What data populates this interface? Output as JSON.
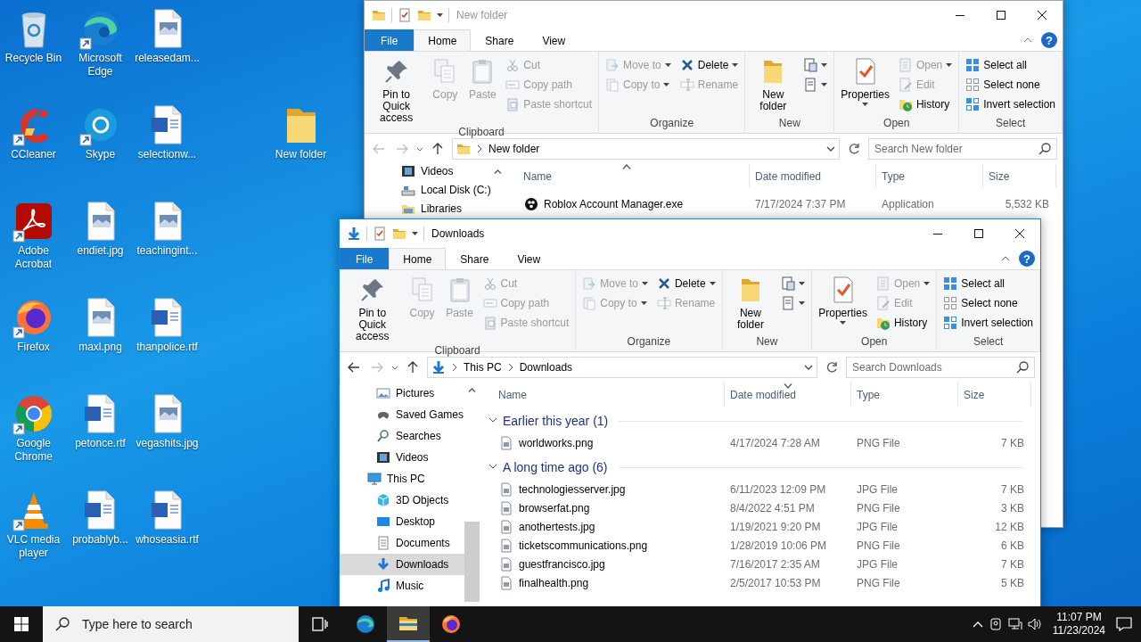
{
  "desktop": {
    "icons": [
      {
        "label": "Recycle Bin",
        "shortcut": false
      },
      {
        "label": "CCleaner",
        "shortcut": true
      },
      {
        "label": "Adobe Acrobat",
        "shortcut": true
      },
      {
        "label": "Firefox",
        "shortcut": true
      },
      {
        "label": "Google Chrome",
        "shortcut": true
      },
      {
        "label": "VLC media player",
        "shortcut": true
      },
      {
        "label": "Microsoft Edge",
        "shortcut": true
      },
      {
        "label": "Skype",
        "shortcut": true
      },
      {
        "label": "endiet.jpg",
        "shortcut": false
      },
      {
        "label": "maxl.png",
        "shortcut": false
      },
      {
        "label": "petonce.rtf",
        "shortcut": false
      },
      {
        "label": "probablyb...",
        "shortcut": false
      },
      {
        "label": "releasedam...",
        "shortcut": false
      },
      {
        "label": "selectionw...",
        "shortcut": false
      },
      {
        "label": "teachingint...",
        "shortcut": false
      },
      {
        "label": "thanpolice.rtf",
        "shortcut": false
      },
      {
        "label": "vegashits.jpg",
        "shortcut": false
      },
      {
        "label": "whoseasia.rtf",
        "shortcut": false
      }
    ],
    "folder": {
      "label": "New folder"
    }
  },
  "windows": [
    {
      "title": "New folder",
      "active": false,
      "tabs": [
        {
          "label": "File",
          "kind": "file",
          "selected": false
        },
        {
          "label": "Home",
          "kind": "tab",
          "selected": true
        },
        {
          "label": "Share",
          "kind": "tab",
          "selected": false
        },
        {
          "label": "View",
          "kind": "tab",
          "selected": false
        }
      ],
      "help": "?",
      "groups": [
        {
          "label": "Clipboard",
          "columns": [
            [
              {
                "label": "Pin to Quick access",
                "kind": "large",
                "disabled": false,
                "dropdown": false
              }
            ],
            [
              {
                "label": "Copy",
                "kind": "large",
                "disabled": true,
                "dropdown": false
              }
            ],
            [
              {
                "label": "Paste",
                "kind": "large",
                "disabled": true,
                "dropdown": false
              }
            ],
            [
              {
                "label": "Cut",
                "kind": "small",
                "disabled": true,
                "dropdown": false
              },
              {
                "label": "Copy path",
                "kind": "small",
                "disabled": true,
                "dropdown": false
              },
              {
                "label": "Paste shortcut",
                "kind": "small",
                "disabled": true,
                "dropdown": false
              }
            ]
          ]
        },
        {
          "label": "Organize",
          "columns": [
            [
              {
                "label": "Move to",
                "kind": "small",
                "disabled": true,
                "dropdown": true
              },
              {
                "label": "Copy to",
                "kind": "small",
                "disabled": true,
                "dropdown": true
              }
            ],
            [
              {
                "label": "Delete",
                "kind": "small",
                "disabled": false,
                "dropdown": true
              },
              {
                "label": "Rename",
                "kind": "small",
                "disabled": true,
                "dropdown": false
              }
            ]
          ]
        },
        {
          "label": "New",
          "columns": [
            [
              {
                "label": "New folder",
                "kind": "large",
                "disabled": false,
                "dropdown": false
              }
            ],
            [
              {
                "kind": "icon",
                "disabled": false,
                "dropdown": true
              },
              {
                "kind": "icon",
                "disabled": false,
                "dropdown": true
              }
            ]
          ]
        },
        {
          "label": "Open",
          "columns": [
            [
              {
                "label": "Properties",
                "kind": "large",
                "disabled": false,
                "dropdown": true
              }
            ],
            [
              {
                "label": "Open",
                "kind": "small",
                "disabled": true,
                "dropdown": true
              },
              {
                "label": "Edit",
                "kind": "small",
                "disabled": true,
                "dropdown": false
              },
              {
                "label": "History",
                "kind": "small",
                "disabled": false,
                "dropdown": false
              }
            ]
          ]
        },
        {
          "label": "Select",
          "columns": [
            [
              {
                "label": "Select all",
                "kind": "small",
                "disabled": false,
                "dropdown": false
              },
              {
                "label": "Select none",
                "kind": "small",
                "disabled": false,
                "dropdown": false
              },
              {
                "label": "Invert selection",
                "kind": "small",
                "disabled": false,
                "dropdown": false
              }
            ]
          ]
        }
      ],
      "address": {
        "back_disabled": true,
        "forward_disabled": true,
        "crumbs": [
          "New folder"
        ]
      },
      "search": {
        "placeholder": "Search New folder"
      },
      "nav": [
        {
          "label": "Videos",
          "selected": false
        },
        {
          "label": "Local Disk (C:)",
          "selected": false
        },
        {
          "label": "Libraries",
          "selected": false
        }
      ],
      "columns": [
        {
          "label": "Name",
          "sorted": true,
          "descending": false
        },
        {
          "label": "Date modified",
          "sorted": false
        },
        {
          "label": "Type",
          "sorted": false
        },
        {
          "label": "Size",
          "sorted": false
        }
      ],
      "rows": [
        {
          "name": "Roblox Account Manager.exe",
          "date": "7/17/2024 7:37 PM",
          "type": "Application",
          "size": "5,532 KB"
        }
      ]
    },
    {
      "title": "Downloads",
      "active": true,
      "tabs": [
        {
          "label": "File",
          "kind": "file",
          "selected": false
        },
        {
          "label": "Home",
          "kind": "tab",
          "selected": true
        },
        {
          "label": "Share",
          "kind": "tab",
          "selected": false
        },
        {
          "label": "View",
          "kind": "tab",
          "selected": false
        }
      ],
      "help": "?",
      "groups": [
        {
          "label": "Clipboard",
          "columns": [
            [
              {
                "label": "Pin to Quick access",
                "kind": "large",
                "disabled": false,
                "dropdown": false
              }
            ],
            [
              {
                "label": "Copy",
                "kind": "large",
                "disabled": true,
                "dropdown": false
              }
            ],
            [
              {
                "label": "Paste",
                "kind": "large",
                "disabled": true,
                "dropdown": false
              }
            ],
            [
              {
                "label": "Cut",
                "kind": "small",
                "disabled": true,
                "dropdown": false
              },
              {
                "label": "Copy path",
                "kind": "small",
                "disabled": true,
                "dropdown": false
              },
              {
                "label": "Paste shortcut",
                "kind": "small",
                "disabled": true,
                "dropdown": false
              }
            ]
          ]
        },
        {
          "label": "Organize",
          "columns": [
            [
              {
                "label": "Move to",
                "kind": "small",
                "disabled": true,
                "dropdown": true
              },
              {
                "label": "Copy to",
                "kind": "small",
                "disabled": true,
                "dropdown": true
              }
            ],
            [
              {
                "label": "Delete",
                "kind": "small",
                "disabled": false,
                "dropdown": true
              },
              {
                "label": "Rename",
                "kind": "small",
                "disabled": true,
                "dropdown": false
              }
            ]
          ]
        },
        {
          "label": "New",
          "columns": [
            [
              {
                "label": "New folder",
                "kind": "large",
                "disabled": false,
                "dropdown": false
              }
            ],
            [
              {
                "kind": "icon",
                "disabled": false,
                "dropdown": true
              },
              {
                "kind": "icon",
                "disabled": false,
                "dropdown": true
              }
            ]
          ]
        },
        {
          "label": "Open",
          "columns": [
            [
              {
                "label": "Properties",
                "kind": "large",
                "disabled": false,
                "dropdown": true
              }
            ],
            [
              {
                "label": "Open",
                "kind": "small",
                "disabled": true,
                "dropdown": true
              },
              {
                "label": "Edit",
                "kind": "small",
                "disabled": true,
                "dropdown": false
              },
              {
                "label": "History",
                "kind": "small",
                "disabled": false,
                "dropdown": false
              }
            ]
          ]
        },
        {
          "label": "Select",
          "columns": [
            [
              {
                "label": "Select all",
                "kind": "small",
                "disabled": false,
                "dropdown": false
              },
              {
                "label": "Select none",
                "kind": "small",
                "disabled": false,
                "dropdown": false
              },
              {
                "label": "Invert selection",
                "kind": "small",
                "disabled": false,
                "dropdown": false
              }
            ]
          ]
        }
      ],
      "address": {
        "back_disabled": false,
        "forward_disabled": true,
        "crumbs": [
          "This PC",
          "Downloads"
        ]
      },
      "search": {
        "placeholder": "Search Downloads"
      },
      "nav": [
        {
          "label": "Pictures",
          "selected": false
        },
        {
          "label": "Saved Games",
          "selected": false
        },
        {
          "label": "Searches",
          "selected": false
        },
        {
          "label": "Videos",
          "selected": false
        },
        {
          "label": "This PC",
          "selected": false,
          "children": [
            {
              "label": "3D Objects",
              "selected": false
            },
            {
              "label": "Desktop",
              "selected": false
            },
            {
              "label": "Documents",
              "selected": false
            },
            {
              "label": "Downloads",
              "selected": true
            },
            {
              "label": "Music",
              "selected": false
            }
          ]
        }
      ],
      "columns": [
        {
          "label": "Name",
          "sorted": false
        },
        {
          "label": "Date modified",
          "sorted": true,
          "descending": true
        },
        {
          "label": "Type",
          "sorted": false
        },
        {
          "label": "Size",
          "sorted": false
        }
      ],
      "file_groups": [
        {
          "label": "Earlier this year (1)",
          "expanded": true,
          "rows": [
            {
              "name": "worldworks.png",
              "date": "4/17/2024 7:28 AM",
              "type": "PNG File",
              "size": "7 KB"
            }
          ]
        },
        {
          "label": "A long time ago (6)",
          "expanded": true,
          "rows": [
            {
              "name": "technologiesserver.jpg",
              "date": "6/11/2023 12:09 PM",
              "type": "JPG File",
              "size": "7 KB"
            },
            {
              "name": "browserfat.png",
              "date": "8/4/2022 4:51 PM",
              "type": "PNG File",
              "size": "3 KB"
            },
            {
              "name": "anothertests.jpg",
              "date": "1/19/2021 9:20 PM",
              "type": "JPG File",
              "size": "12 KB"
            },
            {
              "name": "ticketscommunications.png",
              "date": "1/28/2019 10:06 PM",
              "type": "PNG File",
              "size": "6 KB"
            },
            {
              "name": "guestfrancisco.jpg",
              "date": "7/16/2017 2:35 AM",
              "type": "JPG File",
              "size": "7 KB"
            },
            {
              "name": "finalhealth.png",
              "date": "2/5/2017 10:53 PM",
              "type": "PNG File",
              "size": "5 KB"
            }
          ]
        }
      ]
    }
  ],
  "taskbar": {
    "search": {
      "placeholder": "Type here to search"
    },
    "apps": [
      {
        "active": false
      },
      {
        "active": true
      },
      {
        "active": false
      }
    ],
    "clock": {
      "time": "11:07 PM",
      "date": "11/23/2024"
    }
  }
}
